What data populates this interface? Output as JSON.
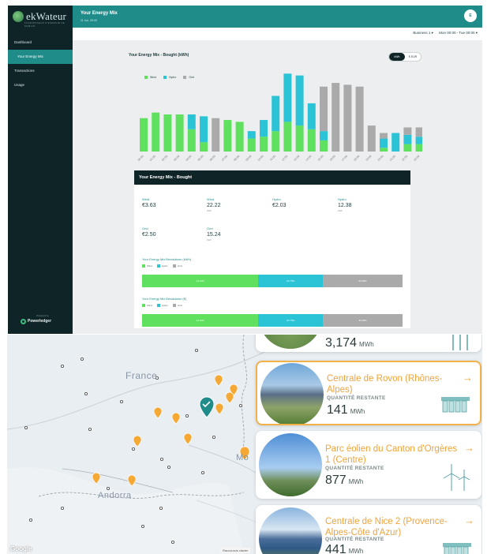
{
  "app": {
    "brand": "ekWateur",
    "brand_tagline": "FOURNISSEUR D'ENERGIE DE DEMAIN",
    "page_title": "Your Energy Mix",
    "page_date": "11 Jun, 09:00",
    "user_initial": "E",
    "powered_by": "Powered by",
    "powered_name": "Powerledger"
  },
  "sidebar": {
    "items": [
      {
        "label": "Dashboard"
      },
      {
        "label": "Your Energy Mix"
      },
      {
        "label": "Transactions"
      },
      {
        "label": "Usage"
      }
    ]
  },
  "filters": {
    "account": "Business 1 ▾",
    "range": "Mon 00:00 - Tue 00:00 ▾"
  },
  "chart_toggle": {
    "left": "kWh",
    "right": "€ EUR"
  },
  "chart_data": {
    "type": "bar",
    "title": "Your Energy Mix - Bought (kWh)",
    "stacked": true,
    "categories": [
      "00:00",
      "01:00",
      "02:00",
      "03:00",
      "04:00",
      "05:00",
      "06:00",
      "07:00",
      "08:00",
      "09:00",
      "10:00",
      "11:00",
      "12:00",
      "13:00",
      "14:00",
      "15:00",
      "16:00",
      "17:00",
      "18:00",
      "19:00",
      "20:00",
      "21:00",
      "22:00",
      "23:00"
    ],
    "series": [
      {
        "name": "Wind",
        "color": "#5fe05f",
        "values": [
          0.9,
          1.05,
          1.0,
          1.0,
          0.6,
          0.25,
          0,
          0.85,
          0.8,
          0.35,
          0.4,
          0.55,
          0.8,
          0.7,
          0.6,
          0.3,
          0,
          0,
          0,
          0,
          0.1,
          0,
          0.2,
          0.2
        ]
      },
      {
        "name": "Hydro",
        "color": "#2ac4d6",
        "values": [
          0,
          0,
          0,
          0,
          0.4,
          0.7,
          0,
          0,
          0,
          0.2,
          0.45,
          0.95,
          1.3,
          1.35,
          0.7,
          0.25,
          0,
          0,
          0,
          0,
          0.25,
          0.5,
          0.25,
          0.2
        ]
      },
      {
        "name": "Grid",
        "color": "#aaaaaa",
        "values": [
          0,
          0,
          0,
          0,
          0,
          0,
          0.9,
          0,
          0,
          0,
          0,
          0,
          0,
          0,
          0,
          1.2,
          1.85,
          1.8,
          1.75,
          0.7,
          0.15,
          0,
          0.2,
          0.25
        ]
      }
    ],
    "ylim": [
      0,
      2
    ],
    "grid": false,
    "legend_placement": "top-left"
  },
  "summary": {
    "title": "Your Energy Mix - Bought",
    "metrics": [
      {
        "label": "Wind",
        "value": "€3.63",
        "unit": ""
      },
      {
        "label": "Wind",
        "value": "22.22",
        "unit": "kWh"
      },
      {
        "label": "Hydro",
        "value": "€2.03",
        "unit": ""
      },
      {
        "label": "Hydro",
        "value": "12.38",
        "unit": "kWh"
      },
      {
        "label": "Grid",
        "value": "€2.50",
        "unit": ""
      },
      {
        "label": "Grid",
        "value": "15.24",
        "unit": "kWh"
      }
    ],
    "breakdowns": [
      {
        "title": "Your Energy Mix Breakdown (kWh)",
        "legend": [
          "Wind",
          "Hydro",
          "Grid"
        ],
        "segments": [
          {
            "label": "44.44%",
            "fraction": 0.4444,
            "color": "#5fe05f"
          },
          {
            "label": "24.76%",
            "fraction": 0.2476,
            "color": "#2ac4d6"
          },
          {
            "label": "30.48%",
            "fraction": 0.3048,
            "color": "#aaaaaa"
          }
        ]
      },
      {
        "title": "Your Energy Mix Breakdown (€)",
        "legend": [
          "Wind",
          "Hydro",
          "Grid"
        ],
        "segments": [
          {
            "label": "44.44%",
            "fraction": 0.4444,
            "color": "#5fe05f"
          },
          {
            "label": "24.76%",
            "fraction": 0.2476,
            "color": "#2ac4d6"
          },
          {
            "label": "30.48%",
            "fraction": 0.3048,
            "color": "#aaaaaa"
          }
        ]
      }
    ]
  },
  "map": {
    "label_france": "France",
    "label_andorra": "Andorra",
    "label_mo": "Mo",
    "google": "Google",
    "shortcuts": "Raccourcis clavier",
    "sites": [
      {
        "name": "Centrale de Rovon (Rhônes-Alpes)",
        "quantity_label": "QUANTITÉ RESTANTE",
        "quantity": "141",
        "unit": "MWh",
        "icon": "dam-icon",
        "selected": true
      },
      {
        "name": "Parc éolien du Canton d'Orgères 1 (Centre)",
        "quantity_label": "QUANTITÉ RESTANTE",
        "quantity": "877",
        "unit": "MWh",
        "icon": "wind-turbine-icon",
        "selected": false
      },
      {
        "name": "Centrale de Nice 2 (Provence-Alpes-Côte d'Azur)",
        "quantity_label": "QUANTITÉ RESTANTE",
        "quantity": "441",
        "unit": "MWh",
        "icon": "dam-icon",
        "selected": false
      }
    ],
    "partial_top": {
      "quantity": "3,174",
      "unit": "MWh"
    }
  },
  "colors": {
    "teal": "#1f8c8a",
    "sidebar": "#0e2427",
    "wind": "#5fe05f",
    "hydro": "#2ac4d6",
    "grid": "#aaaaaa",
    "accent_orange": "#f2a33a"
  }
}
